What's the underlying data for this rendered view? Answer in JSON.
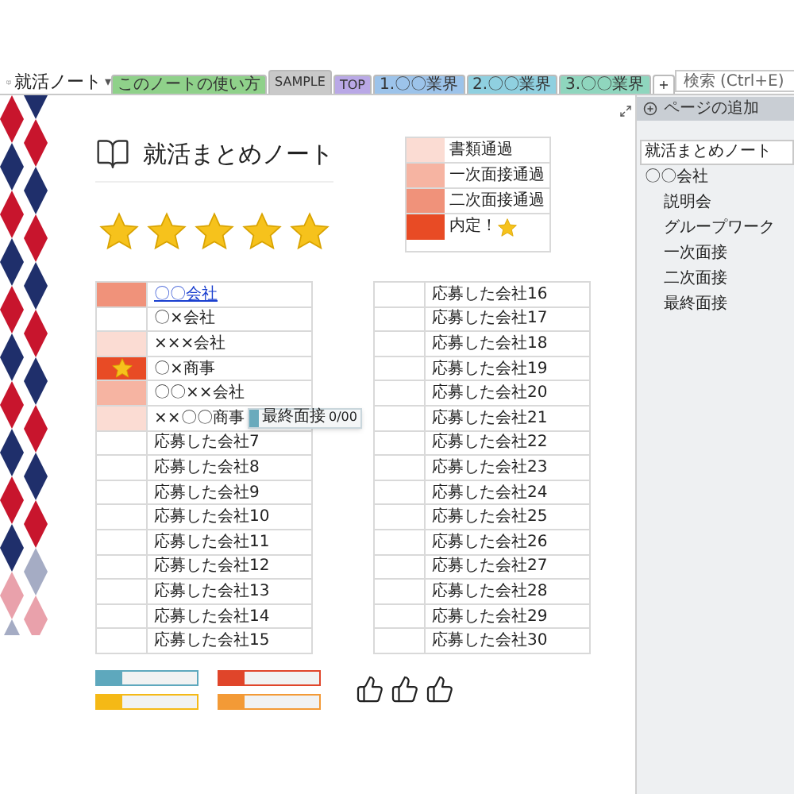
{
  "notebook": {
    "title": "就活ノート",
    "caret": "▾"
  },
  "tabs": [
    {
      "label": "このノートの使い方",
      "color": "#8fd18a",
      "selected": false
    },
    {
      "label": "SAMPLE",
      "color": "#c9c9c9",
      "selected": true
    },
    {
      "label": "TOP",
      "color": "#b9a8e6",
      "selected": false
    },
    {
      "label": "1.〇〇業界",
      "color": "#9cc3ea",
      "selected": false
    },
    {
      "label": "2.〇〇業界",
      "color": "#8fd0e0",
      "selected": false
    },
    {
      "label": "3.〇〇業界",
      "color": "#8fd6be",
      "selected": false
    },
    {
      "label": "+",
      "color": "#ffffff",
      "selected": false
    }
  ],
  "search": {
    "placeholder": "検索 (Ctrl+E)"
  },
  "page": {
    "title": "就活まとめノート",
    "stars": 5
  },
  "legend": [
    {
      "label": "書類通過",
      "color": "#fbdcd3",
      "star": false
    },
    {
      "label": "一次面接通過",
      "color": "#f6b4a2",
      "star": false
    },
    {
      "label": "二次面接通過",
      "color": "#f0927a",
      "star": false
    },
    {
      "label": "内定！",
      "color": "#e84b25",
      "star": true
    }
  ],
  "tables": [
    [
      {
        "name": "〇〇会社",
        "color": "#f0927a",
        "star": false,
        "link": true
      },
      {
        "name": "〇×会社",
        "star": false,
        "link": false
      },
      {
        "name": "×××会社",
        "color": "#fbdcd3",
        "star": false,
        "link": false
      },
      {
        "name": "〇×商事",
        "color": "#e84b25",
        "star": true,
        "link": false
      },
      {
        "name": "〇〇××会社",
        "color": "#f6b4a2",
        "star": false,
        "link": false
      },
      {
        "name": "××〇〇商事",
        "color": "#fbdcd3",
        "star": false,
        "link": false,
        "tag": {
          "label": "最終面接",
          "value": "0/00"
        }
      },
      {
        "name": "応募した会社7",
        "star": false,
        "link": false
      },
      {
        "name": "応募した会社8",
        "star": false,
        "link": false
      },
      {
        "name": "応募した会社9",
        "star": false,
        "link": false
      },
      {
        "name": "応募した会社10",
        "star": false,
        "link": false
      },
      {
        "name": "応募した会社11",
        "star": false,
        "link": false
      },
      {
        "name": "応募した会社12",
        "star": false,
        "link": false
      },
      {
        "name": "応募した会社13",
        "star": false,
        "link": false
      },
      {
        "name": "応募した会社14",
        "star": false,
        "link": false
      },
      {
        "name": "応募した会社15",
        "star": false,
        "link": false
      }
    ],
    [
      {
        "name": "応募した会社16",
        "star": false,
        "link": false
      },
      {
        "name": "応募した会社17",
        "star": false,
        "link": false
      },
      {
        "name": "応募した会社18",
        "star": false,
        "link": false
      },
      {
        "name": "応募した会社19",
        "star": false,
        "link": false
      },
      {
        "name": "応募した会社20",
        "star": false,
        "link": false
      },
      {
        "name": "応募した会社21",
        "star": false,
        "link": false
      },
      {
        "name": "応募した会社22",
        "star": false,
        "link": false
      },
      {
        "name": "応募した会社23",
        "star": false,
        "link": false
      },
      {
        "name": "応募した会社24",
        "star": false,
        "link": false
      },
      {
        "name": "応募した会社25",
        "star": false,
        "link": false
      },
      {
        "name": "応募した会社26",
        "star": false,
        "link": false
      },
      {
        "name": "応募した会社27",
        "star": false,
        "link": false
      },
      {
        "name": "応募した会社28",
        "star": false,
        "link": false
      },
      {
        "name": "応募した会社29",
        "star": false,
        "link": false
      },
      {
        "name": "応募した会社30",
        "star": false,
        "link": false
      }
    ]
  ],
  "progress_bars": [
    {
      "color": "#5ea8bd",
      "level": 0.25
    },
    {
      "color": "#e0452a",
      "level": 0.25
    },
    {
      "color": "#f5b916",
      "level": 0.25
    },
    {
      "color": "#f39a36",
      "level": 0.25
    }
  ],
  "sidebar": {
    "add_page": "ページの追加",
    "pages": [
      {
        "label": "就活まとめノート",
        "selected": true
      },
      {
        "label": "〇〇会社",
        "selected": false,
        "children": [
          {
            "label": "説明会",
            "selected": false
          },
          {
            "label": "グループワーク",
            "selected": false
          },
          {
            "label": "一次面接",
            "selected": false
          },
          {
            "label": "二次面接",
            "selected": false
          },
          {
            "label": "最終面接",
            "selected": false
          }
        ]
      }
    ]
  }
}
